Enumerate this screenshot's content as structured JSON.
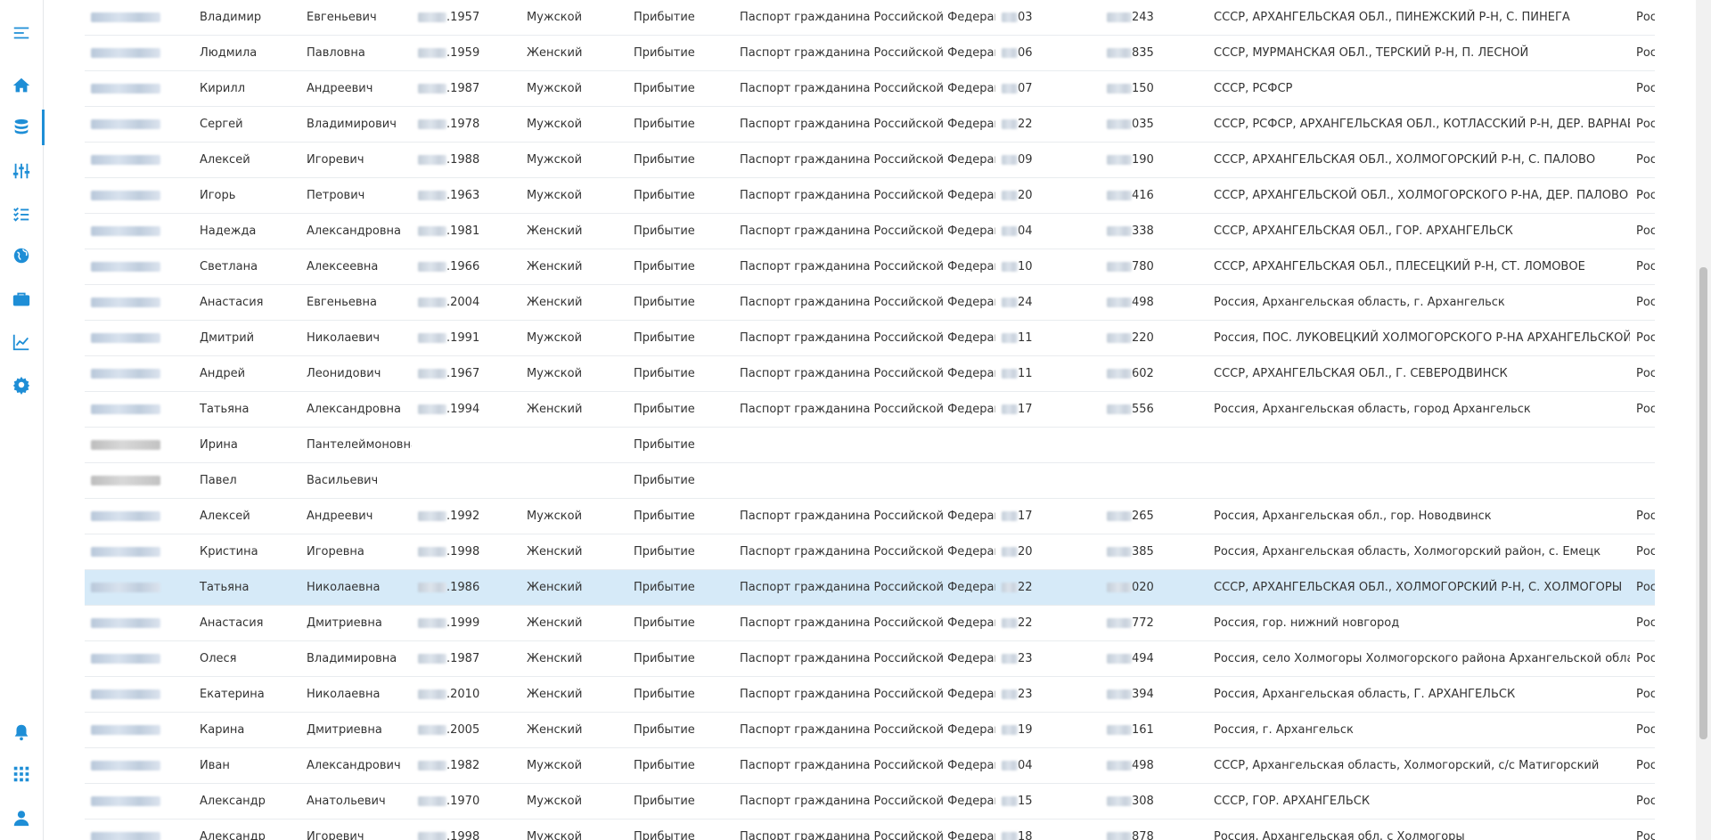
{
  "sidebar": {
    "accent_color": "#1e8ed6",
    "top_items": [
      {
        "icon": "menu-icon"
      },
      {
        "icon": "home-icon"
      },
      {
        "icon": "database-icon",
        "active": true
      },
      {
        "icon": "sliders-icon"
      },
      {
        "icon": "checklist-icon"
      },
      {
        "icon": "globe-icon"
      },
      {
        "icon": "briefcase-icon"
      },
      {
        "icon": "chart-line-icon"
      },
      {
        "icon": "gear-icon"
      }
    ],
    "bottom_items": [
      {
        "icon": "bell-icon"
      },
      {
        "icon": "apps-grid-icon"
      },
      {
        "icon": "user-icon"
      }
    ]
  },
  "table": {
    "selected_row_index": 16,
    "rows": [
      {
        "first_name": "Владимир",
        "patronymic": "Евгеньевич",
        "birth_year": ".1957",
        "sex": "Мужской",
        "event": "Прибытие",
        "doc_type": "Паспорт гражданина Российской Федерации",
        "doc_series": "03",
        "doc_number": "243",
        "address": "СССР, АРХАНГЕЛЬСКАЯ ОБЛ., ПИНЕЖСКИЙ Р-Н, С. ПИНЕГА",
        "country": "Рос"
      },
      {
        "first_name": "Людмила",
        "patronymic": "Павловна",
        "birth_year": ".1959",
        "sex": "Женский",
        "event": "Прибытие",
        "doc_type": "Паспорт гражданина Российской Федерации",
        "doc_series": "06",
        "doc_number": "835",
        "address": "СССР, МУРМАНСКАЯ ОБЛ., ТЕРСКИЙ Р-Н, П. ЛЕСНОЙ",
        "country": "Рос"
      },
      {
        "first_name": "Кирилл",
        "patronymic": "Андреевич",
        "birth_year": ".1987",
        "sex": "Мужской",
        "event": "Прибытие",
        "doc_type": "Паспорт гражданина Российской Федерации",
        "doc_series": "07",
        "doc_number": "150",
        "address": "СССР, РСФСР",
        "country": "Рос"
      },
      {
        "first_name": "Сергей",
        "patronymic": "Владимирович",
        "birth_year": ".1978",
        "sex": "Мужской",
        "event": "Прибытие",
        "doc_type": "Паспорт гражданина Российской Федерации",
        "doc_series": "22",
        "doc_number": "035",
        "address": "СССР, РСФСР, АРХАНГЕЛЬСКАЯ ОБЛ., КОТЛАССКИЙ Р-Н, ДЕР. ВАРНАВИНО",
        "country": "Рос"
      },
      {
        "first_name": "Алексей",
        "patronymic": "Игоревич",
        "birth_year": ".1988",
        "sex": "Мужской",
        "event": "Прибытие",
        "doc_type": "Паспорт гражданина Российской Федерации",
        "doc_series": "09",
        "doc_number": "190",
        "address": "СССР, АРХАНГЕЛЬСКАЯ ОБЛ., ХОЛМОГОРСКИЙ Р-Н, С. ПАЛОВО",
        "country": "Рос"
      },
      {
        "first_name": "Игорь",
        "patronymic": "Петрович",
        "birth_year": ".1963",
        "sex": "Мужской",
        "event": "Прибытие",
        "doc_type": "Паспорт гражданина Российской Федерации",
        "doc_series": "20",
        "doc_number": "416",
        "address": "СССР, АРХАНГЕЛЬСКОЙ ОБЛ., ХОЛМОГОРСКОГО Р-НА, ДЕР. ПАЛОВО",
        "country": "Рос"
      },
      {
        "first_name": "Надежда",
        "patronymic": "Александровна",
        "birth_year": ".1981",
        "sex": "Женский",
        "event": "Прибытие",
        "doc_type": "Паспорт гражданина Российской Федерации",
        "doc_series": "04",
        "doc_number": "338",
        "address": "СССР, АРХАНГЕЛЬСКАЯ ОБЛ., ГОР. АРХАНГЕЛЬСК",
        "country": "Рос"
      },
      {
        "first_name": "Светлана",
        "patronymic": "Алексеевна",
        "birth_year": ".1966",
        "sex": "Женский",
        "event": "Прибытие",
        "doc_type": "Паспорт гражданина Российской Федерации",
        "doc_series": "10",
        "doc_number": "780",
        "address": "СССР, АРХАНГЕЛЬСКАЯ ОБЛ., ПЛЕСЕЦКИЙ Р-Н, СТ. ЛОМОВОЕ",
        "country": "Рос"
      },
      {
        "first_name": "Анастасия",
        "patronymic": "Евгеньевна",
        "birth_year": ".2004",
        "sex": "Женский",
        "event": "Прибытие",
        "doc_type": "Паспорт гражданина Российской Федерации",
        "doc_series": "24",
        "doc_number": "498",
        "address": "Россия, Архангельская область, г. Архангельск",
        "country": "Рос"
      },
      {
        "first_name": "Дмитрий",
        "patronymic": "Николаевич",
        "birth_year": ".1991",
        "sex": "Мужской",
        "event": "Прибытие",
        "doc_type": "Паспорт гражданина Российской Федерации",
        "doc_series": "11",
        "doc_number": "220",
        "address": "Россия, ПОС. ЛУКОВЕЦКИЙ ХОЛМОГОРСКОГО Р-НА АРХАНГЕЛЬСКОЙ ОБЛ.",
        "country": "Рос"
      },
      {
        "first_name": "Андрей",
        "patronymic": "Леонидович",
        "birth_year": ".1967",
        "sex": "Мужской",
        "event": "Прибытие",
        "doc_type": "Паспорт гражданина Российской Федерации",
        "doc_series": "11",
        "doc_number": "602",
        "address": "СССР, АРХАНГЕЛЬСКАЯ ОБЛ., Г. СЕВЕРОДВИНСК",
        "country": "Рос"
      },
      {
        "first_name": "Татьяна",
        "patronymic": "Александровна",
        "birth_year": ".1994",
        "sex": "Женский",
        "event": "Прибытие",
        "doc_type": "Паспорт гражданина Российской Федерации",
        "doc_series": "17",
        "doc_number": "556",
        "address": "Россия, Архангельская область, город Архангельск",
        "country": "Рос"
      },
      {
        "first_name": "Ирина",
        "patronymic": "Пантелеймоновна",
        "birth_year": "",
        "sex": "",
        "event": "Прибытие",
        "doc_type": "",
        "doc_series": "",
        "doc_number": "",
        "address": "",
        "country": "",
        "gray_name": true
      },
      {
        "first_name": "Павел",
        "patronymic": "Васильевич",
        "birth_year": "",
        "sex": "",
        "event": "Прибытие",
        "doc_type": "",
        "doc_series": "",
        "doc_number": "",
        "address": "",
        "country": "",
        "gray_name": true
      },
      {
        "first_name": "Алексей",
        "patronymic": "Андреевич",
        "birth_year": ".1992",
        "sex": "Мужской",
        "event": "Прибытие",
        "doc_type": "Паспорт гражданина Российской Федерации",
        "doc_series": "17",
        "doc_number": "265",
        "address": "Россия, Архангельская обл., гор. Новодвинск",
        "country": "Рос"
      },
      {
        "first_name": "Кристина",
        "patronymic": "Игоревна",
        "birth_year": ".1998",
        "sex": "Женский",
        "event": "Прибытие",
        "doc_type": "Паспорт гражданина Российской Федерации",
        "doc_series": "20",
        "doc_number": "385",
        "address": "Россия, Архангельская область, Холмогорский район, с. Емецк",
        "country": "Рос"
      },
      {
        "first_name": "Татьяна",
        "patronymic": "Николаевна",
        "birth_year": ".1986",
        "sex": "Женский",
        "event": "Прибытие",
        "doc_type": "Паспорт гражданина Российской Федерации",
        "doc_series": "22",
        "doc_number": "020",
        "address": "СССР, АРХАНГЕЛЬСКАЯ ОБЛ., ХОЛМОГОРСКИЙ Р-Н, С. ХОЛМОГОРЫ",
        "country": "Рос"
      },
      {
        "first_name": "Анастасия",
        "patronymic": "Дмитриевна",
        "birth_year": ".1999",
        "sex": "Женский",
        "event": "Прибытие",
        "doc_type": "Паспорт гражданина Российской Федерации",
        "doc_series": "22",
        "doc_number": "772",
        "address": "Россия, гор. нижний новгород",
        "country": "Рос"
      },
      {
        "first_name": "Олеся",
        "patronymic": "Владимировна",
        "birth_year": ".1987",
        "sex": "Женский",
        "event": "Прибытие",
        "doc_type": "Паспорт гражданина Российской Федерации",
        "doc_series": "23",
        "doc_number": "494",
        "address": "Россия, село Холмогоры Холмогорского района Архангельской области",
        "country": "Рос"
      },
      {
        "first_name": "Екатерина",
        "patronymic": "Николаевна",
        "birth_year": ".2010",
        "sex": "Женский",
        "event": "Прибытие",
        "doc_type": "Паспорт гражданина Российской Федерации",
        "doc_series": "23",
        "doc_number": "394",
        "address": "Россия, Архангельская область, Г. АРХАНГЕЛЬСК",
        "country": "Рос"
      },
      {
        "first_name": "Карина",
        "patronymic": "Дмитриевна",
        "birth_year": ".2005",
        "sex": "Женский",
        "event": "Прибытие",
        "doc_type": "Паспорт гражданина Российской Федерации",
        "doc_series": "19",
        "doc_number": "161",
        "address": "Россия, г. Архангельск",
        "country": "Рос"
      },
      {
        "first_name": "Иван",
        "patronymic": "Александрович",
        "birth_year": ".1982",
        "sex": "Мужской",
        "event": "Прибытие",
        "doc_type": "Паспорт гражданина Российской Федерации",
        "doc_series": "04",
        "doc_number": "498",
        "address": "СССР, Архангельская область, Холмогорский, с/с Матигорский",
        "country": "Рос"
      },
      {
        "first_name": "Александр",
        "patronymic": "Анатольевич",
        "birth_year": ".1970",
        "sex": "Мужской",
        "event": "Прибытие",
        "doc_type": "Паспорт гражданина Российской Федерации",
        "doc_series": "15",
        "doc_number": "308",
        "address": "СССР, ГОР. АРХАНГЕЛЬСК",
        "country": "Рос"
      },
      {
        "first_name": "Александр",
        "patronymic": "Игоревич",
        "birth_year": ".1998",
        "sex": "Мужской",
        "event": "Прибытие",
        "doc_type": "Паспорт гражданина Российской Федерации",
        "doc_series": "18",
        "doc_number": "878",
        "address": "Россия, Архангельская обл. с Холмогоры",
        "country": "Рос"
      }
    ]
  }
}
